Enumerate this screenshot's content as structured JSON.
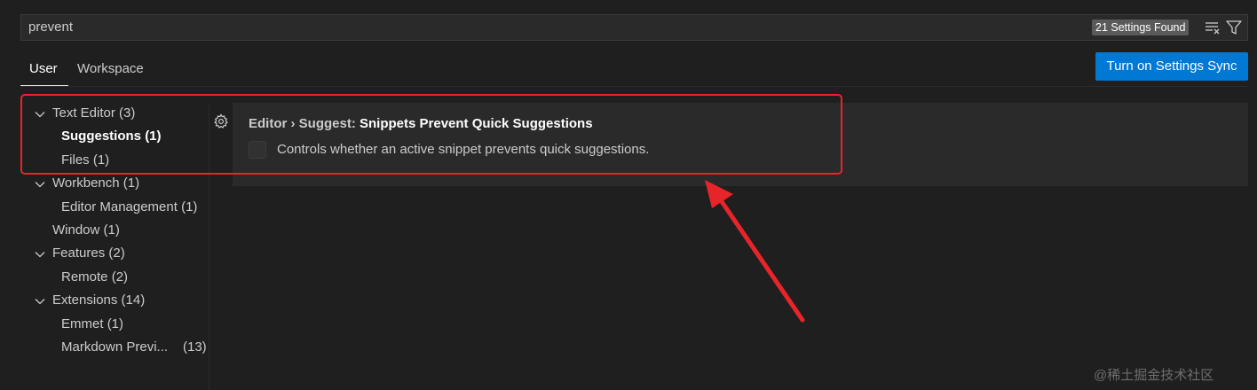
{
  "search": {
    "value": "prevent",
    "result_count": "21 Settings Found",
    "clear_icon": "clear-filter-icon",
    "filter_icon": "funnel-icon"
  },
  "tabs": [
    {
      "label": "User",
      "active": true
    },
    {
      "label": "Workspace",
      "active": false
    }
  ],
  "sync_button": {
    "label": "Turn on Settings Sync"
  },
  "toc": {
    "text_editor": {
      "label": "Text Editor",
      "count": "(3)"
    },
    "suggestions": {
      "label": "Suggestions",
      "count": "(1)"
    },
    "files": {
      "label": "Files",
      "count": "(1)"
    },
    "workbench": {
      "label": "Workbench",
      "count": "(1)"
    },
    "editor_management": {
      "label": "Editor Management",
      "count": "(1)"
    },
    "window": {
      "label": "Window",
      "count": "(1)"
    },
    "features": {
      "label": "Features",
      "count": "(2)"
    },
    "remote": {
      "label": "Remote",
      "count": "(2)"
    },
    "extensions": {
      "label": "Extensions",
      "count": "(14)"
    },
    "emmet": {
      "label": "Emmet",
      "count": "(1)"
    },
    "markdown_preview": {
      "label": "Markdown Previ...",
      "count": "(13)"
    }
  },
  "setting": {
    "category": "Editor › Suggest: ",
    "name": "Snippets Prevent Quick Suggestions",
    "description": "Controls whether an active snippet prevents quick suggestions.",
    "checked": false
  },
  "colors": {
    "accent": "#0078d4",
    "annotation": "#e8242b",
    "background": "#1f1f1f"
  },
  "watermark": "@稀土掘金技术社区"
}
